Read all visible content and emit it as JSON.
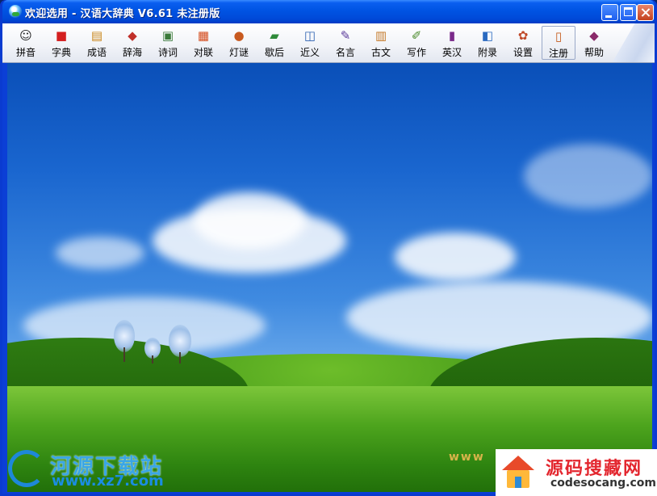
{
  "window": {
    "title": "欢迎选用 - 汉语大辞典 V6.61 未注册版"
  },
  "toolbar": {
    "items": [
      {
        "label": "拼音",
        "icon": "face-icon",
        "glyph": "☺",
        "color": "#222222"
      },
      {
        "label": "字典",
        "icon": "red-book-icon",
        "glyph": "■",
        "color": "#d42020"
      },
      {
        "label": "成语",
        "icon": "scroll-icon",
        "glyph": "▤",
        "color": "#c9861a"
      },
      {
        "label": "辞海",
        "icon": "books-icon",
        "glyph": "◆",
        "color": "#c0302a"
      },
      {
        "label": "诗词",
        "icon": "poem-icon",
        "glyph": "▣",
        "color": "#3a7a3a"
      },
      {
        "label": "对联",
        "icon": "couplet-icon",
        "glyph": "▦",
        "color": "#d44a1a"
      },
      {
        "label": "灯谜",
        "icon": "lantern-icon",
        "glyph": "●",
        "color": "#c85a20"
      },
      {
        "label": "歇后",
        "icon": "stack-icon",
        "glyph": "▰",
        "color": "#2f8a3a"
      },
      {
        "label": "近义",
        "icon": "open-book-icon",
        "glyph": "◫",
        "color": "#2a5fb0"
      },
      {
        "label": "名言",
        "icon": "note-icon",
        "glyph": "✎",
        "color": "#5a3a9a"
      },
      {
        "label": "古文",
        "icon": "ancient-book-icon",
        "glyph": "▥",
        "color": "#c47a2a"
      },
      {
        "label": "写作",
        "icon": "writing-icon",
        "glyph": "✐",
        "color": "#4a8a2a"
      },
      {
        "label": "英汉",
        "icon": "bookshelf-icon",
        "glyph": "▮",
        "color": "#7a2a8a"
      },
      {
        "label": "附录",
        "icon": "appendix-icon",
        "glyph": "◧",
        "color": "#2a6ac0"
      },
      {
        "label": "设置",
        "icon": "settings-icon",
        "glyph": "✿",
        "color": "#c04a2a"
      },
      {
        "label": "注册",
        "icon": "register-icon",
        "glyph": "▯",
        "color": "#c45a1a"
      },
      {
        "label": "帮助",
        "icon": "help-book-icon",
        "glyph": "◆",
        "color": "#8a2a6a"
      }
    ]
  },
  "watermarks": {
    "left_name": "河源下载站",
    "left_url": "www.xz7.com",
    "www_text": "www",
    "right_name": "源码搜藏网",
    "right_url": "codesocang.com"
  },
  "colors": {
    "titlebar": "#0054e3",
    "close_button": "#c4411d"
  }
}
